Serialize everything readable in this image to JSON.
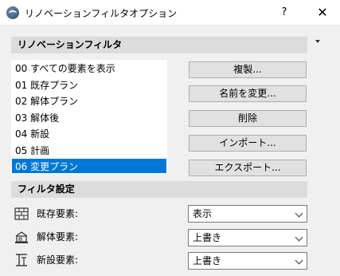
{
  "window": {
    "title": "リノベーションフィルタオプション",
    "help_label": "?",
    "close_label": "✕"
  },
  "filter_section": {
    "header": "リノベーションフィルタ",
    "items": [
      {
        "label": "00 すべての要素を表示"
      },
      {
        "label": "01 既存プラン"
      },
      {
        "label": "02 解体プラン"
      },
      {
        "label": "03 解体後"
      },
      {
        "label": "04 新設"
      },
      {
        "label": "05 計画"
      },
      {
        "label": "06 変更プラン"
      }
    ],
    "selected_index": 6,
    "buttons": {
      "duplicate": "複製...",
      "rename": "名前を変更...",
      "delete": "削除",
      "import": "インポート...",
      "export": "エクスポート..."
    }
  },
  "settings_section": {
    "header": "フィルタ設定",
    "rows": [
      {
        "label": "既存要素:",
        "value": "表示",
        "icon": "existing-wall-icon"
      },
      {
        "label": "解体要素:",
        "value": "上書き",
        "icon": "demolish-icon"
      },
      {
        "label": "新設要素:",
        "value": "上書き",
        "icon": "new-construction-icon"
      }
    ]
  },
  "colors": {
    "selection": "#0078d7",
    "section_header": "#dcdcdc",
    "button": "#e1e1e1"
  }
}
